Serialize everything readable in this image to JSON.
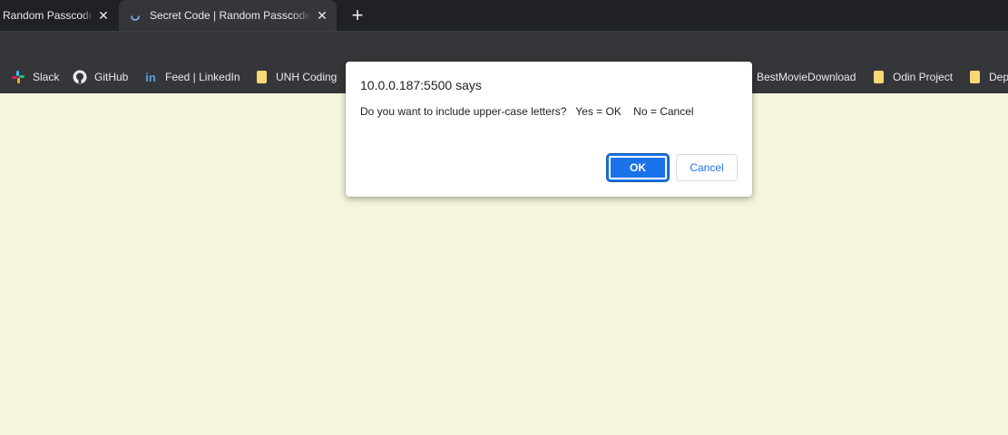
{
  "tabs": [
    {
      "title": "Random Passcode G",
      "active": false
    },
    {
      "title": "Secret Code | Random Passcode G",
      "active": true
    }
  ],
  "new_tab_glyph": "+",
  "close_glyph": "✕",
  "bookmarks": [
    {
      "label": "Slack",
      "icon": "slack-icon"
    },
    {
      "label": "GitHub",
      "icon": "github-icon"
    },
    {
      "label": "Feed | LinkedIn",
      "icon": "linkedin-icon"
    },
    {
      "label": "UNH Coding",
      "icon": "folder-icon"
    },
    {
      "label": "BestMovieDownload",
      "icon": ""
    },
    {
      "label": "Odin Project",
      "icon": "folder-icon"
    },
    {
      "label": "Dep",
      "icon": "folder-icon"
    }
  ],
  "dialog": {
    "origin": "10.0.0.187:5500 says",
    "message": "Do you want to include upper-case letters?   Yes = OK    No = Cancel",
    "ok_label": "OK",
    "cancel_label": "Cancel"
  },
  "colors": {
    "page_background": "#f5f5dc",
    "accent": "#1a73e8",
    "chrome_dark": "#202124",
    "chrome_toolbar": "#35363a"
  }
}
